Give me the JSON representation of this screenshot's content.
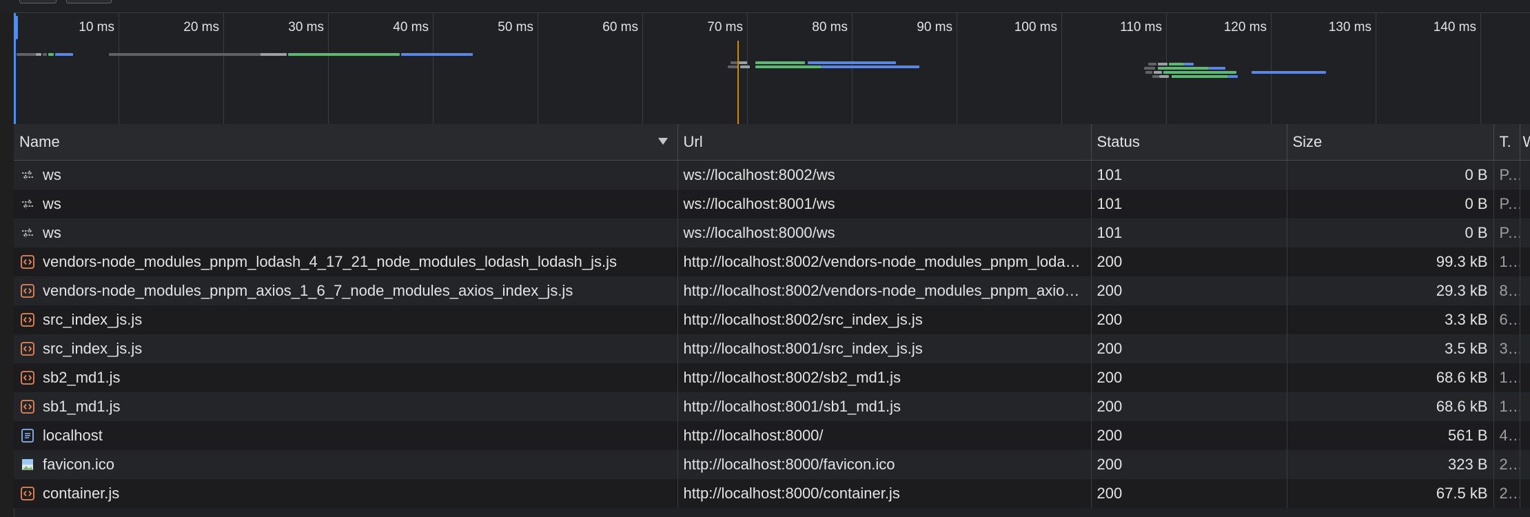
{
  "overview": {
    "ticks": [
      "10 ms",
      "20 ms",
      "30 ms",
      "40 ms",
      "50 ms",
      "60 ms",
      "70 ms",
      "80 ms",
      "90 ms",
      "100 ms",
      "110 ms",
      "120 ms",
      "130 ms",
      "140 ms"
    ]
  },
  "table": {
    "columns": {
      "name": "Name",
      "url": "Url",
      "status": "Status",
      "size": "Size",
      "time": "T.",
      "waterfall": "W"
    },
    "rows": [
      {
        "icon": "websocket-icon",
        "name": "ws",
        "url": "ws://localhost:8002/ws",
        "status": "101",
        "size": "0 B",
        "time": "P..."
      },
      {
        "icon": "websocket-icon",
        "name": "ws",
        "url": "ws://localhost:8001/ws",
        "status": "101",
        "size": "0 B",
        "time": "P..."
      },
      {
        "icon": "websocket-icon",
        "name": "ws",
        "url": "ws://localhost:8000/ws",
        "status": "101",
        "size": "0 B",
        "time": "P..."
      },
      {
        "icon": "script-icon",
        "name": "vendors-node_modules_pnpm_lodash_4_17_21_node_modules_lodash_lodash_js.js",
        "url": "http://localhost:8002/vendors-node_modules_pnpm_lodash_4_17_21_node_modules_lodash_lodash_js.js",
        "status": "200",
        "size": "99.3 kB",
        "time": "1..."
      },
      {
        "icon": "script-icon",
        "name": "vendors-node_modules_pnpm_axios_1_6_7_node_modules_axios_index_js.js",
        "url": "http://localhost:8002/vendors-node_modules_pnpm_axios_1_6_7_node_modules_axios_index_js.js",
        "status": "200",
        "size": "29.3 kB",
        "time": "8..."
      },
      {
        "icon": "script-icon",
        "name": "src_index_js.js",
        "url": "http://localhost:8002/src_index_js.js",
        "status": "200",
        "size": "3.3 kB",
        "time": "6..."
      },
      {
        "icon": "script-icon",
        "name": "src_index_js.js",
        "url": "http://localhost:8001/src_index_js.js",
        "status": "200",
        "size": "3.5 kB",
        "time": "3..."
      },
      {
        "icon": "script-icon",
        "name": "sb2_md1.js",
        "url": "http://localhost:8002/sb2_md1.js",
        "status": "200",
        "size": "68.6 kB",
        "time": "1..."
      },
      {
        "icon": "script-icon",
        "name": "sb1_md1.js",
        "url": "http://localhost:8001/sb1_md1.js",
        "status": "200",
        "size": "68.6 kB",
        "time": "1..."
      },
      {
        "icon": "document-icon",
        "name": "localhost",
        "url": "http://localhost:8000/",
        "status": "200",
        "size": "561 B",
        "time": "4..."
      },
      {
        "icon": "image-icon",
        "name": "favicon.ico",
        "url": "http://localhost:8000/favicon.ico",
        "status": "200",
        "size": "323 B",
        "time": "2..."
      },
      {
        "icon": "script-icon",
        "name": "container.js",
        "url": "http://localhost:8000/container.js",
        "status": "200",
        "size": "67.5 kB",
        "time": "2..."
      }
    ]
  },
  "colors": {
    "background": "#202124",
    "waiting": "#9aa0a6",
    "queued": "#5f6368",
    "download": "#5c86e6",
    "ttfb": "#5bb974",
    "load_line": "#f29900",
    "script_icon": "#e8875b",
    "document_icon": "#8ab4f8"
  }
}
